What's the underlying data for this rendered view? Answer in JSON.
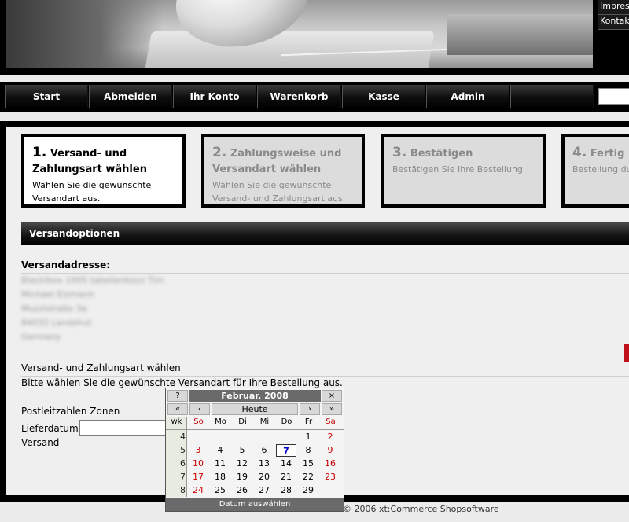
{
  "banner": {
    "links": [
      "Impressum",
      "Kontakt"
    ]
  },
  "nav": {
    "items": [
      "Start",
      "Abmelden",
      "Ihr Konto",
      "Warenkorb",
      "Kasse",
      "Admin"
    ]
  },
  "steps": [
    {
      "num": "1.",
      "title": "Versand- und Zahlungsart wählen",
      "desc": "Wählen Sie die gewünschte Versandart aus.",
      "active": true
    },
    {
      "num": "2.",
      "title": "Zahlungsweise und Versandart wählen",
      "desc": "Wählen Sie die gewünschte Versand- und Zahlungsart aus.",
      "active": false
    },
    {
      "num": "3.",
      "title": "Bestätigen",
      "desc": "Bestätigen Sie Ihre Bestellung",
      "active": false
    },
    {
      "num": "4.",
      "title": "Fertig",
      "desc": "Bestellung durchgeführt",
      "active": false
    }
  ],
  "section": {
    "title": "Versandoptionen",
    "address_label": "Versandadresse:",
    "address_lines": [
      "Blacklbox 1005 tabellenbozz Tim",
      "Michael Eismann",
      "Muzzlstraße 3a",
      "84032 Landshut",
      "Germany"
    ],
    "method_title": "Versand- und Zahlungsart wählen",
    "method_desc": "Bitte wählen Sie die gewünschte Versandart für Ihre Bestellung aus.",
    "zones_label": "Postleitzahlen Zonen",
    "delivery_label": "Lieferdatum:",
    "shipping_label": "Versand"
  },
  "footer": {
    "text": "© 2006 xt:Commerce Shopsoftware"
  },
  "calendar": {
    "help": "?",
    "title": "Februar, 2008",
    "close": "×",
    "prev_year": "«",
    "prev_month": "‹",
    "today": "Heute",
    "next_month": "›",
    "next_year": "»",
    "wk_label": "wk",
    "day_headers": [
      "So",
      "Mo",
      "Di",
      "Mi",
      "Do",
      "Fr",
      "Sa"
    ],
    "weeks": [
      {
        "wk": "4",
        "days": [
          "",
          "",
          "",
          "",
          "",
          "1",
          "2"
        ]
      },
      {
        "wk": "5",
        "days": [
          "3",
          "4",
          "5",
          "6",
          "7",
          "8",
          "9"
        ]
      },
      {
        "wk": "6",
        "days": [
          "10",
          "11",
          "12",
          "13",
          "14",
          "15",
          "16"
        ]
      },
      {
        "wk": "7",
        "days": [
          "17",
          "18",
          "19",
          "20",
          "21",
          "22",
          "23"
        ]
      },
      {
        "wk": "8",
        "days": [
          "24",
          "25",
          "26",
          "27",
          "28",
          "29",
          ""
        ]
      }
    ],
    "selected_day": "7",
    "status": "Datum auswählen"
  }
}
